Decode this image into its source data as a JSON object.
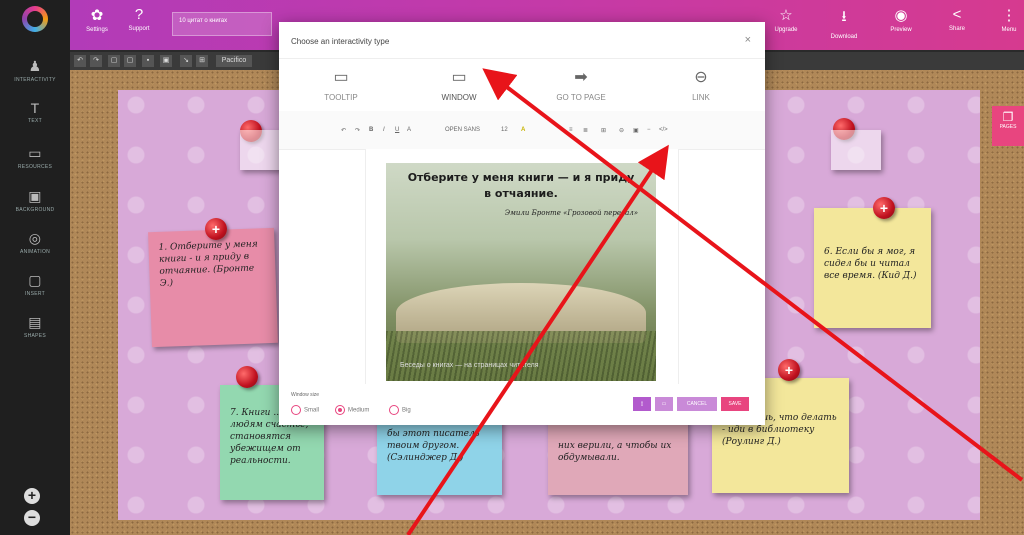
{
  "sidebar": {
    "items": [
      {
        "label": "INTERACTIVITY",
        "icon": "person-icon"
      },
      {
        "label": "TEXT",
        "icon": "text-icon"
      },
      {
        "label": "RESOURCES",
        "icon": "resources-icon"
      },
      {
        "label": "BACKGROUND",
        "icon": "background-icon"
      },
      {
        "label": "ANIMATION",
        "icon": "animation-icon"
      },
      {
        "label": "INSERT",
        "icon": "insert-icon"
      },
      {
        "label": "SHAPES",
        "icon": "shapes-icon"
      }
    ]
  },
  "topbar": {
    "settings_label": "Settings",
    "support_label": "Support",
    "project_name": "10 цитат о книгах",
    "upgrade_label": "Upgrade",
    "download_label": "Download",
    "preview_label": "Preview",
    "share_label": "Share",
    "menu_label": "Menu"
  },
  "toolbar2": {
    "text_label": "Pacifico"
  },
  "page_button": {
    "label": "PAGES"
  },
  "modal": {
    "title": "Choose an interactivity type",
    "close": "×",
    "tabs": [
      {
        "label": "TOOLTIP",
        "icon": "tooltip-icon"
      },
      {
        "label": "WINDOW",
        "icon": "window-icon"
      },
      {
        "label": "GO TO PAGE",
        "icon": "arrow-right-icon"
      },
      {
        "label": "LINK",
        "icon": "link-icon"
      }
    ],
    "active_tab": "WINDOW",
    "editor": {
      "font": "OPEN SANS",
      "size": "12"
    },
    "quote": {
      "line1": "Отберите у меня книги — и я приду",
      "line2": "в отчаяние.",
      "author": "Эмили Бронте «Грозовой перевал»",
      "bottom": "Беседы о книгах — на страницах читателя"
    },
    "window_size_label": "Window size",
    "size_options": [
      "Small",
      "Medium",
      "Big"
    ],
    "selected_size": "Medium",
    "cancel_label": "CANCEL",
    "save_label": "SAVE"
  },
  "notes": [
    {
      "text": "1. Отберите у меня книги - и я приду в отчаяние. (Бронте Э.)",
      "color": "#e78ca8"
    },
    {
      "text": "6. Если бы я мог, я сидел бы и читал все время. (Кид Д.)",
      "color": "#f3e79b"
    },
    {
      "text": "7. Книги ... людям счастье, становятся убежищем от реальности.",
      "color": "#93d8b0"
    },
    {
      "text": "бы этот писатель твоим другом. (Сэлинджер Д.)",
      "color": "#8fd3e8"
    },
    {
      "text": "них верили, а чтобы их обдумывали.",
      "color": "#e0a8b8"
    },
    {
      "text": "Не знаешь, что делать - иди в библиотеку (Роулинг Д.)",
      "color": "#f3e79b"
    }
  ]
}
